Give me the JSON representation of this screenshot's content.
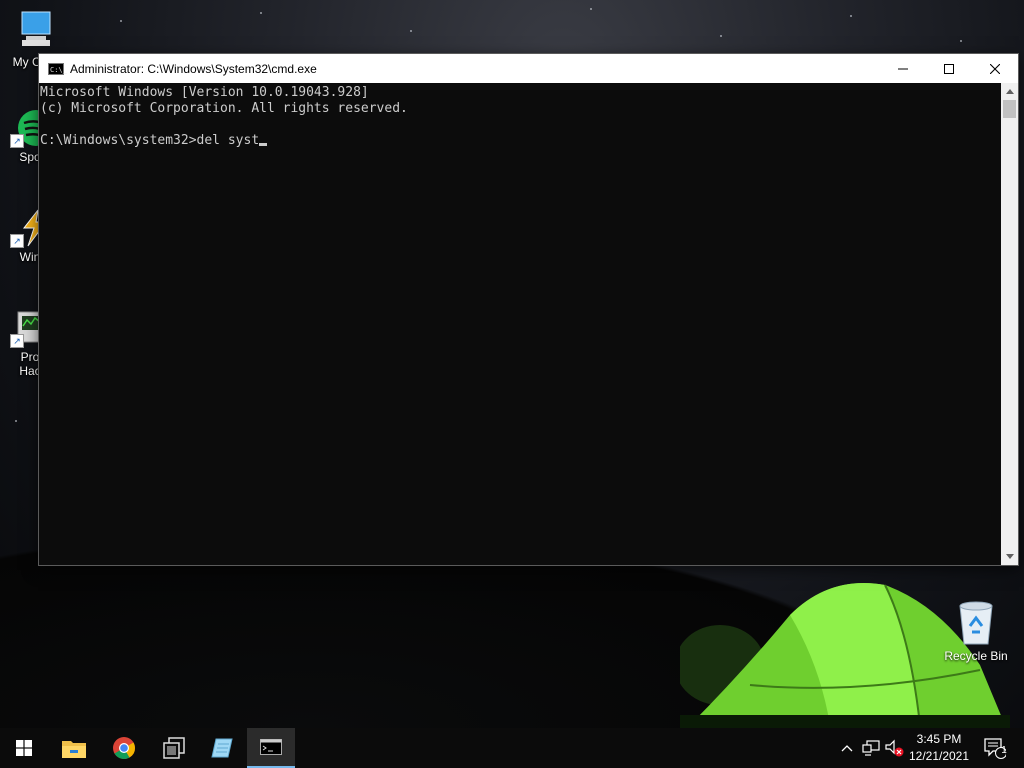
{
  "desktop": {
    "icons": [
      {
        "label": "My Co",
        "icon": "computer-icon"
      },
      {
        "label": "Spo",
        "icon": "spotify-icon"
      },
      {
        "label": "Win",
        "icon": "winamp-icon"
      },
      {
        "label": "Pro",
        "label2": "Hac",
        "icon": "process-hacker-icon"
      }
    ],
    "recycle_bin": {
      "label": "Recycle Bin",
      "icon": "recycle-bin-icon"
    }
  },
  "window": {
    "title": "Administrator: C:\\Windows\\System32\\cmd.exe",
    "app_icon_text": "C:\\_",
    "console_lines": [
      "Microsoft Windows [Version 10.0.19043.928]",
      "(c) Microsoft Corporation. All rights reserved.",
      "",
      "C:\\Windows\\system32>del syst"
    ]
  },
  "taskbar": {
    "apps": [
      "start-icon",
      "file-explorer-icon",
      "chrome-icon",
      "task-view-icon",
      "notepad-icon",
      "cmd-icon"
    ],
    "clock": {
      "time": "3:45 PM",
      "date": "12/21/2021"
    },
    "notification_count": "1"
  },
  "colors": {
    "console_bg": "#0c0c0c",
    "console_fg": "#cccccc",
    "taskbar_bg": "#0b0b0b",
    "tent_green": "#7be03a"
  }
}
